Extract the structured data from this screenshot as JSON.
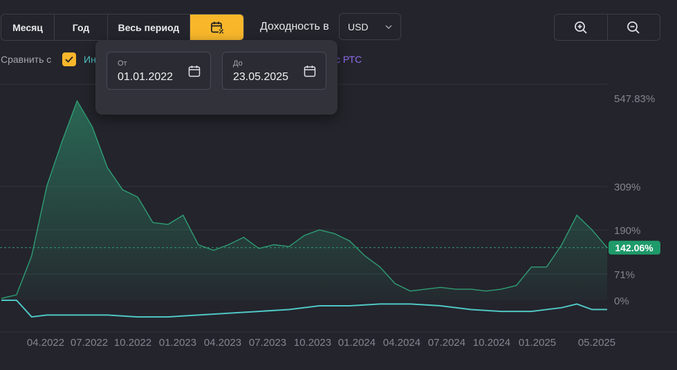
{
  "toolbar": {
    "periods": [
      "Месяц",
      "Год",
      "Весь период"
    ],
    "calendar_icon": "calendar-percent-icon",
    "yield_label": "Доходность в",
    "currency": "USD",
    "zoom_in_icon": "zoom-in-icon",
    "zoom_out_icon": "zoom-out-icon",
    "accent_color": "#f8b72b"
  },
  "compare": {
    "label": "Сравнить с",
    "checked": true,
    "item_1": "Ин",
    "item_2": "с РТС",
    "item_1_color": "#4fc8c5",
    "item_2_color": "#8f6cf0"
  },
  "date_popup": {
    "from_label": "От",
    "from_value": "01.01.2022",
    "to_label": "До",
    "to_value": "23.05.2025"
  },
  "chart_data": {
    "type": "area",
    "y_axis_ticks": [
      {
        "value": 547.83,
        "label": "547.83%"
      },
      {
        "value": 309,
        "label": "309%"
      },
      {
        "value": 190,
        "label": "190%"
      },
      {
        "value": 71,
        "label": "71%"
      },
      {
        "value": 0,
        "label": "0%"
      }
    ],
    "x_axis_ticks": [
      "04.2022",
      "07.2022",
      "10.2022",
      "01.2023",
      "04.2023",
      "07.2023",
      "10.2023",
      "01.2024",
      "04.2024",
      "07.2024",
      "10.2024",
      "01.2025",
      "05.2025"
    ],
    "current_value_label": "142.06%",
    "series": [
      {
        "color": "#2e9e74",
        "x": [
          "2022-01",
          "2022-02",
          "2022-03",
          "2022-04",
          "2022-05",
          "2022-06",
          "2022-07",
          "2022-08",
          "2022-09",
          "2022-10",
          "2022-11",
          "2022-12",
          "2023-01",
          "2023-02",
          "2023-03",
          "2023-04",
          "2023-05",
          "2023-06",
          "2023-07",
          "2023-08",
          "2023-09",
          "2023-10",
          "2023-11",
          "2023-12",
          "2024-01",
          "2024-02",
          "2024-03",
          "2024-04",
          "2024-05",
          "2024-06",
          "2024-07",
          "2024-08",
          "2024-09",
          "2024-10",
          "2024-11",
          "2024-12",
          "2025-01",
          "2025-02",
          "2025-03",
          "2025-04",
          "2025-05"
        ],
        "values": [
          5,
          15,
          120,
          310,
          430,
          540,
          470,
          360,
          300,
          280,
          210,
          205,
          230,
          150,
          135,
          150,
          170,
          140,
          150,
          145,
          175,
          190,
          180,
          160,
          120,
          90,
          45,
          25,
          30,
          35,
          30,
          30,
          25,
          30,
          40,
          90,
          90,
          150,
          230,
          190,
          142.06
        ]
      },
      {
        "color": "#4fc8c5",
        "x": [
          "2022-01",
          "2022-02",
          "2022-03",
          "2022-04",
          "2022-06",
          "2022-08",
          "2022-10",
          "2022-12",
          "2023-02",
          "2023-04",
          "2023-06",
          "2023-08",
          "2023-10",
          "2023-12",
          "2024-02",
          "2024-04",
          "2024-06",
          "2024-08",
          "2024-10",
          "2024-12",
          "2025-02",
          "2025-03",
          "2025-04",
          "2025-05"
        ],
        "values": [
          0,
          0,
          -45,
          -40,
          -40,
          -40,
          -45,
          -45,
          -40,
          -35,
          -30,
          -25,
          -15,
          -15,
          -10,
          -10,
          -15,
          -25,
          -30,
          -30,
          -20,
          -10,
          -25,
          -25
        ]
      }
    ]
  }
}
